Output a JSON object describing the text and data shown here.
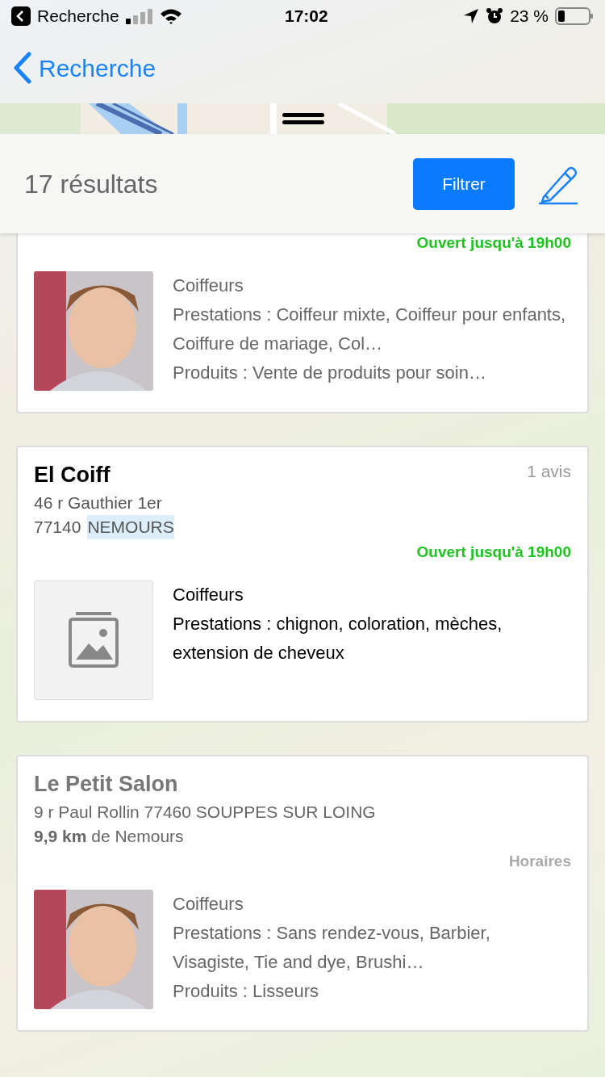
{
  "status_bar": {
    "back_app": "Recherche",
    "time": "17:02",
    "battery": "23 %"
  },
  "nav": {
    "back_label": "Recherche"
  },
  "results": {
    "count": "17 résultats",
    "filter_button": "Filtrer"
  },
  "cards": [
    {
      "dimmed": true,
      "cut_top": true,
      "status": {
        "text": "Ouvert jusqu'à 19h00",
        "kind": "open"
      },
      "has_photo": true,
      "category": "Coiffeurs",
      "lines": [
        "Prestations : Coiffeur mixte, Coiffeur pour enfants, Coiffure de mariage, Col…",
        "Produits : Vente de produits pour soin…"
      ]
    },
    {
      "dimmed": false,
      "cut_top": false,
      "title": "El Coiff",
      "rating": "1 avis",
      "address": [
        "46 r Gauthier 1er"
      ],
      "postcode": "77140",
      "city": "NEMOURS",
      "status": {
        "text": "Ouvert jusqu'à 19h00",
        "kind": "open"
      },
      "has_photo": false,
      "category": "Coiffeurs",
      "lines": [
        "Prestations : chignon, coloration, mèches, extension de cheveux"
      ]
    },
    {
      "dimmed": true,
      "cut_top": false,
      "title": "Le Petit Salon",
      "address": [
        "9 r Paul Rollin 77460 SOUPPES SUR LOING"
      ],
      "distance": "**9,9 km** de Nemours",
      "status": {
        "text": "Horaires",
        "kind": "hours"
      },
      "has_photo": true,
      "category": "Coiffeurs",
      "lines": [
        "Prestations : Sans rendez-vous, Barbier, Visagiste, Tie and dye, Brushi…",
        "Produits : Lisseurs"
      ]
    }
  ]
}
